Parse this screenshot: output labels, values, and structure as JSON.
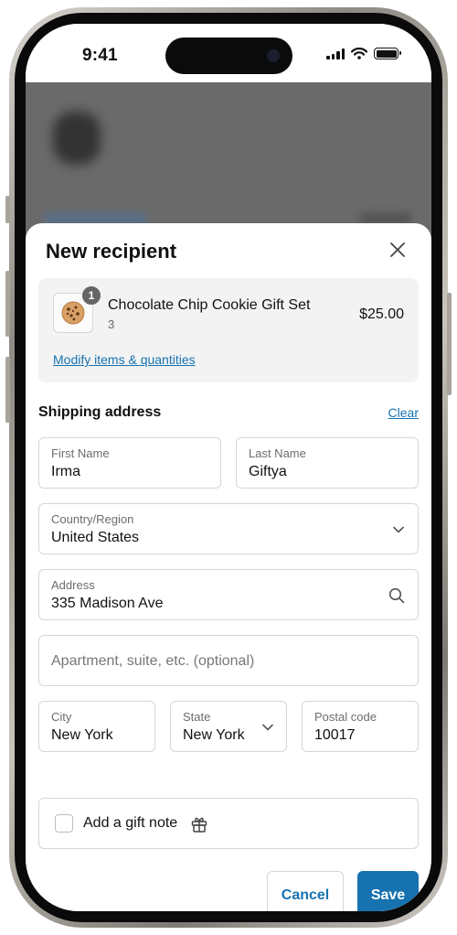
{
  "status_bar": {
    "time": "9:41"
  },
  "sheet": {
    "title": "New recipient",
    "product": {
      "quantity_badge": "1",
      "name": "Chocolate Chip Cookie Gift Set",
      "quantity": "3",
      "price": "$25.00",
      "modify_link": "Modify items & quantities"
    },
    "shipping": {
      "title": "Shipping address",
      "clear_link": "Clear",
      "first_name": {
        "label": "First Name",
        "value": "Irma"
      },
      "last_name": {
        "label": "Last Name",
        "value": "Giftya"
      },
      "country": {
        "label": "Country/Region",
        "value": "United States"
      },
      "address": {
        "label": "Address",
        "value": "335 Madison Ave"
      },
      "apartment": {
        "placeholder": "Apartment, suite, etc. (optional)"
      },
      "city": {
        "label": "City",
        "value": "New York"
      },
      "state": {
        "label": "State",
        "value": "New York"
      },
      "postal": {
        "label": "Postal code",
        "value": "10017"
      }
    },
    "gift_note": {
      "label": "Add a gift note",
      "checked": false
    },
    "buttons": {
      "cancel": "Cancel",
      "save": "Save"
    }
  },
  "colors": {
    "accent": "#1773b0",
    "backdrop": "#6a6a6a",
    "card_bg": "#f3f3f3"
  },
  "icons": [
    "close-icon",
    "cookie-icon",
    "chevron-down-icon",
    "search-icon",
    "gift-icon",
    "signal-icon",
    "wifi-icon",
    "battery-icon"
  ]
}
